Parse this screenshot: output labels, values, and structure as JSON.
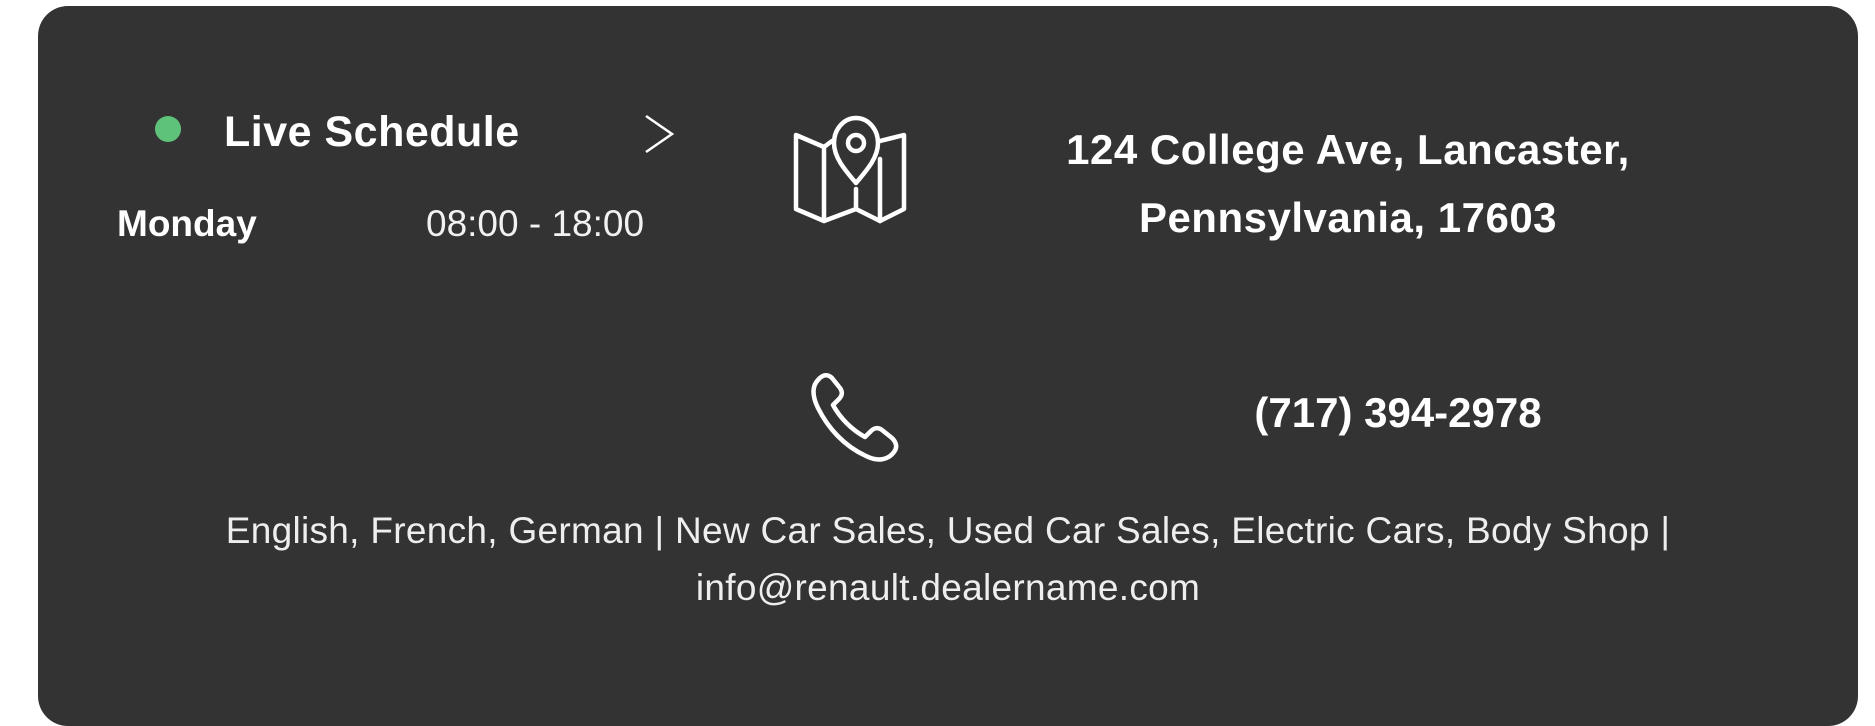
{
  "schedule": {
    "title": "Live Schedule",
    "status_color": "#5fc27a",
    "status_icon": "green-dot",
    "expand_icon": "chevron-right-icon",
    "day": "Monday",
    "hours": "08:00 - 18:00"
  },
  "address": {
    "icon": "map-pin-icon",
    "line1": "124 College Ave, Lancaster,",
    "line2": "Pennsylvania, 17603"
  },
  "phone": {
    "icon": "phone-icon",
    "number": "(717) 394-2978"
  },
  "info": {
    "languages_services": "English, French, German | New Car Sales, Used Car Sales, Electric Cars, Body Shop |",
    "email": "info@renault.dealername.com"
  },
  "colors": {
    "card_background": "#333333",
    "text": "#ffffff"
  }
}
